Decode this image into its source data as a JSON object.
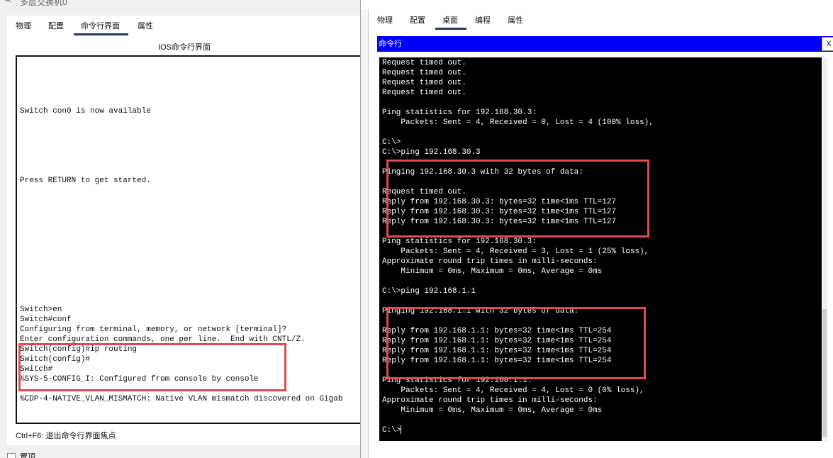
{
  "left_window": {
    "title": "多层交换机0",
    "tabs": [
      "物理",
      "配置",
      "命令行界面",
      "属性"
    ],
    "active_tab": 2,
    "ios_header": "IOS命令行界面",
    "console_lines": [
      "",
      "",
      "",
      "",
      "",
      "Switch con0 is now available",
      "",
      "",
      "",
      "",
      "",
      "",
      "Press RETURN to get started.",
      "",
      "",
      "",
      "",
      "",
      "",
      "",
      "",
      "",
      "",
      "",
      "",
      "Switch>en",
      "Switch#conf",
      "Configuring from terminal, memory, or network [terminal]?",
      "Enter configuration commands, one per line.  End with CNTL/Z.",
      "Switch(config)#ip routing",
      "Switch(config)#",
      "Switch#",
      "%SYS-5-CONFIG_I: Configured from console by console",
      "",
      "%CDP-4-NATIVE_VLAN_MISMATCH: Native VLAN mismatch discovered on Gigab"
    ],
    "hint": "Ctrl+F6: 退出命令行界面焦点",
    "bottom_checkbox": "置顶"
  },
  "right_window": {
    "tabs": [
      "物理",
      "配置",
      "桌面",
      "编程",
      "属性"
    ],
    "active_tab": 2,
    "cmd_title": "命令行",
    "close_label": "X",
    "terminal_lines": [
      "Request timed out.",
      "Request timed out.",
      "Request timed out.",
      "Request timed out.",
      "",
      "Ping statistics for 192.168.30.3:",
      "    Packets: Sent = 4, Received = 0, Lost = 4 (100% loss),",
      "",
      "C:\\>",
      "C:\\>ping 192.168.30.3",
      "",
      "Pinging 192.168.30.3 with 32 bytes of data:",
      "",
      "Request timed out.",
      "Reply from 192.168.30.3: bytes=32 time<1ms TTL=127",
      "Reply from 192.168.30.3: bytes=32 time<1ms TTL=127",
      "Reply from 192.168.30.3: bytes=32 time<1ms TTL=127",
      "",
      "Ping statistics for 192.168.30.3:",
      "    Packets: Sent = 4, Received = 3, Lost = 1 (25% loss),",
      "Approximate round trip times in milli-seconds:",
      "    Minimum = 0ms, Maximum = 0ms, Average = 0ms",
      "",
      "C:\\>ping 192.168.1.1",
      "",
      "Pinging 192.168.1.1 with 32 bytes of data:",
      "",
      "Reply from 192.168.1.1: bytes=32 time<1ms TTL=254",
      "Reply from 192.168.1.1: bytes=32 time<1ms TTL=254",
      "Reply from 192.168.1.1: bytes=32 time<1ms TTL=254",
      "Reply from 192.168.1.1: bytes=32 time<1ms TTL=254",
      "",
      "Ping statistics for 192.168.1.1:",
      "    Packets: Sent = 4, Received = 4, Lost = 0 (0% loss),",
      "Approximate round trip times in milli-seconds:",
      "    Minimum = 0ms, Maximum = 0ms, Average = 0ms",
      "",
      "C:\\>"
    ]
  },
  "colors": {
    "highlight": "#e04b4b",
    "cmd_bar": "#0000ff",
    "tab_underline": "#1d3b6b",
    "terminal_bg": "#000000"
  }
}
